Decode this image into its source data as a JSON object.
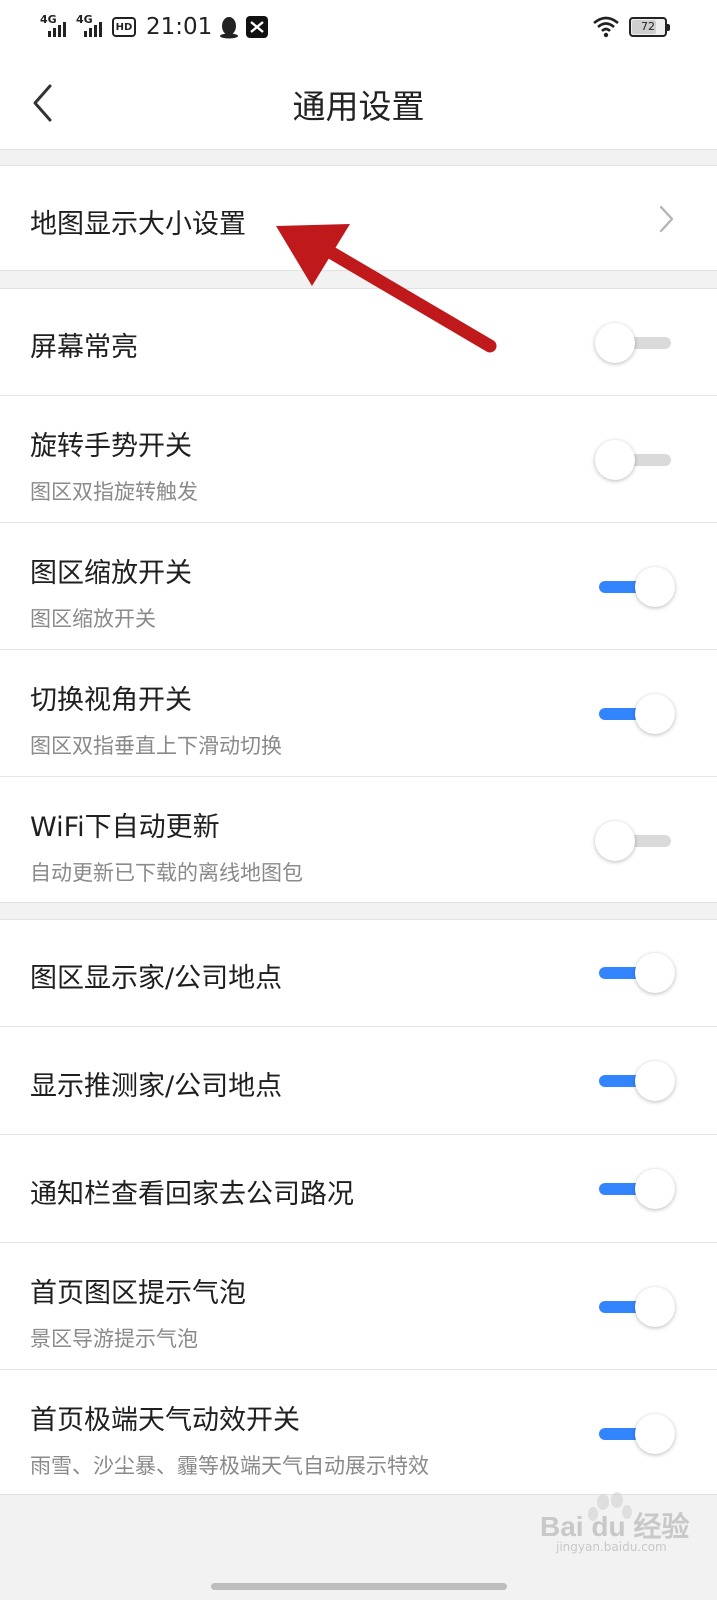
{
  "status_bar": {
    "signal1_label": "4G",
    "signal2_label": "4G",
    "hd_label": "HD",
    "time": "21:01",
    "battery": "72",
    "battery_level": 0.72
  },
  "header": {
    "title": "通用设置",
    "back_icon": "chevron-left-icon"
  },
  "groups": [
    {
      "items": [
        {
          "title": "地图显示大小设置",
          "control": "chevron-right-icon"
        }
      ]
    },
    {
      "items": [
        {
          "title": "屏幕常亮",
          "subtitle": "",
          "toggle": false
        },
        {
          "title": "旋转手势开关",
          "subtitle": "图区双指旋转触发",
          "toggle": false
        },
        {
          "title": "图区缩放开关",
          "subtitle": "图区缩放开关",
          "toggle": true
        },
        {
          "title": "切换视角开关",
          "subtitle": "图区双指垂直上下滑动切换",
          "toggle": true
        },
        {
          "title": "WiFi下自动更新",
          "subtitle": "自动更新已下载的离线地图包",
          "toggle": false
        }
      ]
    },
    {
      "items": [
        {
          "title": "图区显示家/公司地点",
          "subtitle": "",
          "toggle": true
        },
        {
          "title": "显示推测家/公司地点",
          "subtitle": "",
          "toggle": true
        },
        {
          "title": "通知栏查看回家去公司路况",
          "subtitle": "",
          "toggle": true
        },
        {
          "title": "首页图区提示气泡",
          "subtitle": "景区导游提示气泡",
          "toggle": true
        },
        {
          "title": "首页极端天气动效开关",
          "subtitle": "雨雪、沙尘暴、霾等极端天气自动展示特效",
          "toggle": true
        }
      ]
    }
  ],
  "colors": {
    "toggle_on": "#3385ff",
    "toggle_off": "#dadada",
    "annotation_arrow": "#c0191c"
  },
  "watermark": {
    "text": "Bai du 经验",
    "sub": "jingyan.baidu.com"
  }
}
